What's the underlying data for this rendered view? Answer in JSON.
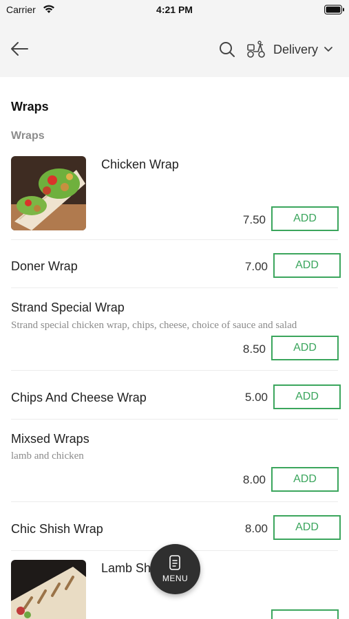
{
  "status_bar": {
    "carrier": "Carrier",
    "time": "4:21 PM"
  },
  "header": {
    "delivery_label": "Delivery"
  },
  "section": {
    "title": "Wraps",
    "category": "Wraps"
  },
  "add_label": "ADD",
  "items": [
    {
      "name": "Chicken Wrap",
      "price": "7.50",
      "has_image": true
    },
    {
      "name": "Doner Wrap",
      "price": "7.00"
    },
    {
      "name": "Strand Special Wrap",
      "description": "Strand special chicken wrap, chips, cheese, choice of sauce and salad",
      "price": "8.50"
    },
    {
      "name": "Chips And Cheese Wrap",
      "price": "5.00"
    },
    {
      "name": "Mixsed Wraps",
      "description": "lamb and chicken",
      "price": "8.00"
    },
    {
      "name": "Chic Shish Wrap",
      "price": "8.00"
    },
    {
      "name": "Lamb Shi",
      "has_image": true
    }
  ],
  "fab": {
    "label": "MENU"
  },
  "colors": {
    "accent_green": "#3aa55c",
    "header_bg": "#f4f4f4",
    "fab_bg": "#2f2f2f"
  }
}
